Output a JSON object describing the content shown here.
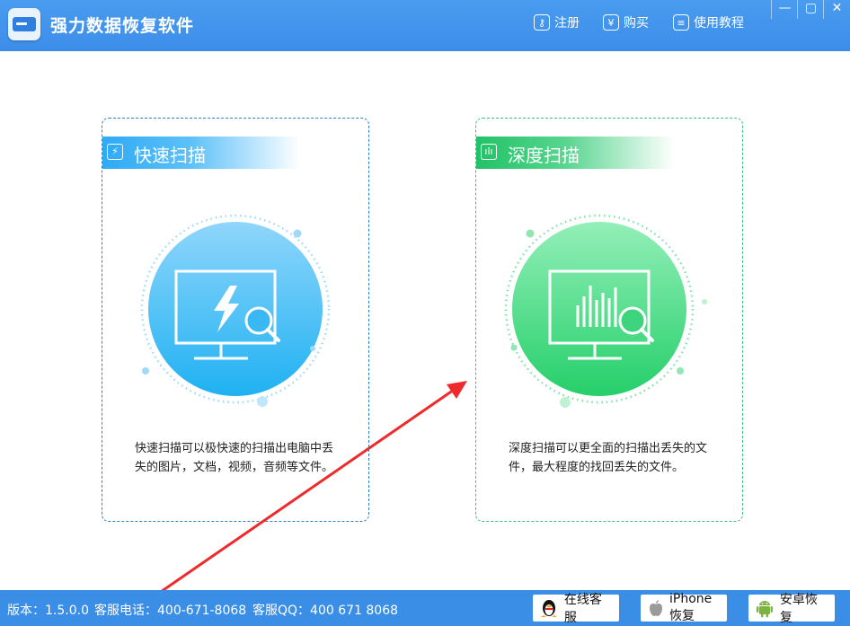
{
  "app": {
    "title": "强力数据恢复软件"
  },
  "toolbar": {
    "register": "注册",
    "buy": "购买",
    "tutorial": "使用教程"
  },
  "window_controls": {
    "minimize": "—",
    "maximize": "▢",
    "close": "✕"
  },
  "quick_scan": {
    "title": "快速扫描",
    "description": "快速扫描可以极快速的扫描出电脑中丢失的图片，文档，视频，音频等文件。",
    "color": "#2eaaf5"
  },
  "deep_scan": {
    "title": "深度扫描",
    "description": "深度扫描可以更全面的扫描出丢失的文件，最大程度的找回丢失的文件。",
    "color": "#22c268"
  },
  "status": {
    "version": "版本：1.5.0.0",
    "phone": "客服电话：400-671-8068",
    "qq": "客服QQ：400 671 8068"
  },
  "buttons": {
    "online_service": "在线客服",
    "iphone_recovery": "iPhone恢复",
    "android_recovery": "安卓恢复"
  }
}
